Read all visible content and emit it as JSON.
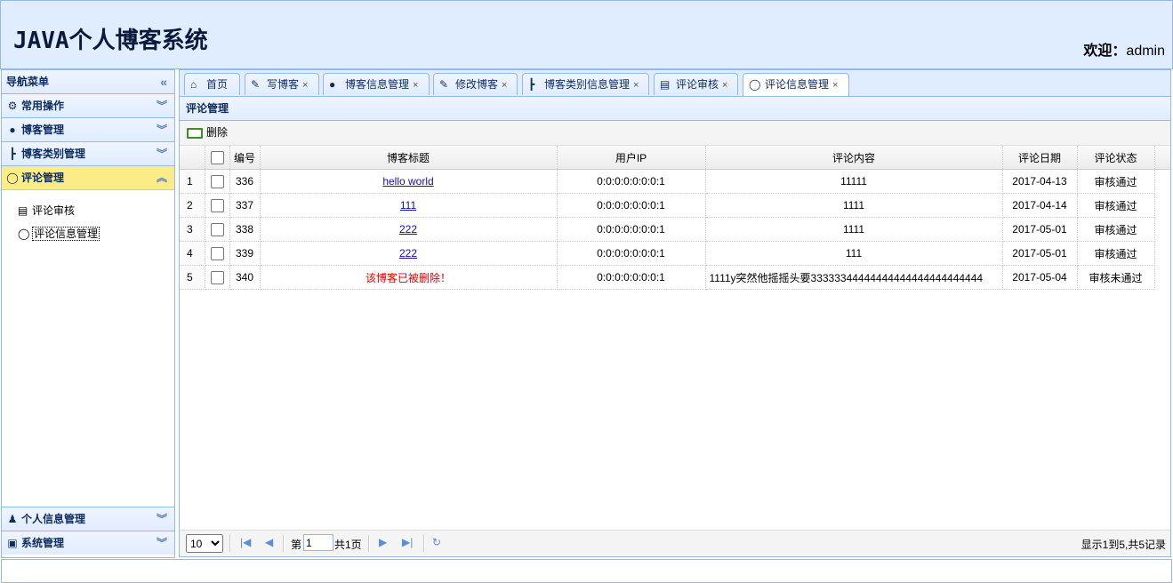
{
  "header": {
    "title": "JAVA个人博客系统",
    "welcome_label": "欢迎：",
    "user": "admin"
  },
  "nav": {
    "title": "导航菜单",
    "sections": [
      {
        "label": "常用操作",
        "icon": "gear-icon"
      },
      {
        "label": "博客管理",
        "icon": "blog-icon"
      },
      {
        "label": "博客类别管理",
        "icon": "tree-icon"
      },
      {
        "label": "评论管理",
        "icon": "comment-icon"
      }
    ],
    "comment_items": [
      {
        "label": "评论审核",
        "icon": "review-icon"
      },
      {
        "label": "评论信息管理",
        "icon": "comment-icon"
      }
    ],
    "bottom_sections": [
      {
        "label": "个人信息管理",
        "icon": "user-icon"
      },
      {
        "label": "系统管理",
        "icon": "system-icon"
      }
    ]
  },
  "tabs": [
    {
      "label": "首页",
      "icon": "home-icon",
      "closable": false
    },
    {
      "label": "写博客",
      "icon": "edit-icon",
      "closable": true
    },
    {
      "label": "博客信息管理",
      "icon": "blog-icon",
      "closable": true
    },
    {
      "label": "修改博客",
      "icon": "edit-icon",
      "closable": true
    },
    {
      "label": "博客类别信息管理",
      "icon": "tree-icon",
      "closable": true
    },
    {
      "label": "评论审核",
      "icon": "review-icon",
      "closable": true
    },
    {
      "label": "评论信息管理",
      "icon": "comment-icon",
      "closable": true,
      "active": true
    }
  ],
  "panel": {
    "title": "评论管理",
    "toolbar": {
      "delete_label": "删除"
    },
    "columns": [
      "编号",
      "博客标题",
      "用户IP",
      "评论内容",
      "评论日期",
      "评论状态"
    ],
    "rows": [
      {
        "n": "1",
        "id": "336",
        "title": "hello world",
        "ip": "0:0:0:0:0:0:0:1",
        "content": "11111",
        "date": "2017-04-13",
        "status": "审核通过"
      },
      {
        "n": "2",
        "id": "337",
        "title": "111",
        "ip": "0:0:0:0:0:0:0:1",
        "content": "1111",
        "date": "2017-04-14",
        "status": "审核通过"
      },
      {
        "n": "3",
        "id": "338",
        "title": "222",
        "ip": "0:0:0:0:0:0:0:1",
        "content": "1111",
        "date": "2017-05-01",
        "status": "审核通过"
      },
      {
        "n": "4",
        "id": "339",
        "title": "222",
        "ip": "0:0:0:0:0:0:0:1",
        "content": "111",
        "date": "2017-05-01",
        "status": "审核通过"
      },
      {
        "n": "5",
        "id": "340",
        "title": "该博客已被删除！",
        "ip": "0:0:0:0:0:0:0:1",
        "content": "1111y突然他摇摇头要33333344444444444444444444444",
        "date": "2017-05-04",
        "status": "审核未通过"
      }
    ],
    "pager": {
      "page_size": "10",
      "page_prefix": "第",
      "page_value": "1",
      "page_suffix": "共1页",
      "info": "显示1到5,共5记录"
    }
  },
  "colors": {
    "accent": "#95b8e7",
    "header_bg": "#e0ecff",
    "active_nav": "#fbec88",
    "deleted": "#e00000"
  }
}
